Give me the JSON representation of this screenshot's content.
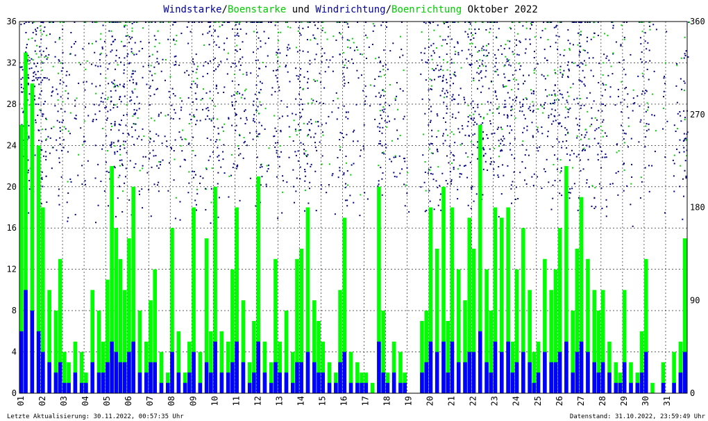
{
  "chart_data": {
    "type": "bar",
    "title_parts": [
      {
        "text": "Windstarke",
        "color": "#000099"
      },
      {
        "text": "/",
        "color": "#000000"
      },
      {
        "text": "Boenstarke",
        "color": "#00cc00"
      },
      {
        "text": " und ",
        "color": "#000000"
      },
      {
        "text": "Windrichtung",
        "color": "#000099"
      },
      {
        "text": "/",
        "color": "#000000"
      },
      {
        "text": "Boenrichtung",
        "color": "#00cc00"
      },
      {
        "text": " Oktober 2022",
        "color": "#000000"
      }
    ],
    "y_left": {
      "min": 0,
      "max": 36,
      "ticks": [
        "0",
        "4",
        "8",
        "12",
        "16",
        "20",
        "24",
        "28",
        "32",
        "36"
      ]
    },
    "y_right": {
      "min": 0,
      "max": 360,
      "ticks": [
        "0",
        "90",
        "180",
        "270",
        "360"
      ]
    },
    "x_days": [
      "01",
      "02",
      "03",
      "04",
      "05",
      "06",
      "07",
      "08",
      "09",
      "10",
      "11",
      "12",
      "13",
      "14",
      "15",
      "16",
      "17",
      "18",
      "19",
      "20",
      "21",
      "22",
      "23",
      "24",
      "25",
      "26",
      "27",
      "28",
      "29",
      "30",
      "31"
    ],
    "x_range": [
      1,
      32
    ],
    "grid": true,
    "colors": {
      "wind": "#0000ff",
      "gust": "#00ff00",
      "direction": "#000080",
      "gust_direction": "#00cc00",
      "grid": "#000000"
    },
    "series": [
      {
        "values": [
          [
            1.0,
            26
          ],
          [
            1.2,
            33
          ],
          [
            1.5,
            30
          ],
          [
            1.8,
            24
          ],
          [
            2.0,
            18
          ],
          [
            2.3,
            10
          ],
          [
            2.6,
            8
          ],
          [
            2.8,
            13
          ],
          [
            3.0,
            4
          ],
          [
            3.2,
            3
          ],
          [
            3.5,
            5
          ],
          [
            3.8,
            4
          ],
          [
            4.0,
            2
          ],
          [
            4.3,
            10
          ],
          [
            4.6,
            8
          ],
          [
            4.8,
            5
          ],
          [
            5.0,
            11
          ],
          [
            5.2,
            22
          ],
          [
            5.4,
            16
          ],
          [
            5.6,
            13
          ],
          [
            5.8,
            10
          ],
          [
            6.0,
            15
          ],
          [
            6.2,
            20
          ],
          [
            6.5,
            8
          ],
          [
            6.8,
            5
          ],
          [
            7.0,
            9
          ],
          [
            7.2,
            12
          ],
          [
            7.5,
            4
          ],
          [
            7.8,
            2
          ],
          [
            8.0,
            16
          ],
          [
            8.3,
            6
          ],
          [
            8.6,
            2
          ],
          [
            8.8,
            5
          ],
          [
            9.0,
            18
          ],
          [
            9.3,
            4
          ],
          [
            9.6,
            15
          ],
          [
            9.8,
            6
          ],
          [
            10.0,
            20
          ],
          [
            10.3,
            6
          ],
          [
            10.6,
            5
          ],
          [
            10.8,
            12
          ],
          [
            11.0,
            18
          ],
          [
            11.3,
            9
          ],
          [
            11.6,
            3
          ],
          [
            11.8,
            7
          ],
          [
            12.0,
            21
          ],
          [
            12.3,
            5
          ],
          [
            12.6,
            3
          ],
          [
            12.8,
            13
          ],
          [
            13.0,
            5
          ],
          [
            13.3,
            8
          ],
          [
            13.6,
            4
          ],
          [
            13.8,
            13
          ],
          [
            14.0,
            14
          ],
          [
            14.3,
            18
          ],
          [
            14.6,
            9
          ],
          [
            14.8,
            7
          ],
          [
            15.0,
            5
          ],
          [
            15.3,
            3
          ],
          [
            15.6,
            2
          ],
          [
            15.8,
            10
          ],
          [
            16.0,
            17
          ],
          [
            16.3,
            4
          ],
          [
            16.6,
            3
          ],
          [
            16.8,
            2
          ],
          [
            17.0,
            2
          ],
          [
            17.3,
            1
          ],
          [
            17.6,
            20
          ],
          [
            17.8,
            8
          ],
          [
            18.0,
            2
          ],
          [
            18.3,
            5
          ],
          [
            18.6,
            4
          ],
          [
            18.8,
            2
          ],
          [
            19.0,
            0
          ],
          [
            19.3,
            0
          ],
          [
            19.6,
            7
          ],
          [
            19.8,
            8
          ],
          [
            20.0,
            18
          ],
          [
            20.3,
            14
          ],
          [
            20.6,
            20
          ],
          [
            20.8,
            7
          ],
          [
            21.0,
            18
          ],
          [
            21.3,
            12
          ],
          [
            21.6,
            9
          ],
          [
            21.8,
            17
          ],
          [
            22.0,
            14
          ],
          [
            22.3,
            26
          ],
          [
            22.6,
            12
          ],
          [
            22.8,
            8
          ],
          [
            23.0,
            18
          ],
          [
            23.3,
            17
          ],
          [
            23.6,
            18
          ],
          [
            23.8,
            5
          ],
          [
            24.0,
            12
          ],
          [
            24.3,
            16
          ],
          [
            24.6,
            10
          ],
          [
            24.8,
            4
          ],
          [
            25.0,
            5
          ],
          [
            25.3,
            13
          ],
          [
            25.6,
            10
          ],
          [
            25.8,
            12
          ],
          [
            26.0,
            16
          ],
          [
            26.3,
            22
          ],
          [
            26.6,
            8
          ],
          [
            26.8,
            14
          ],
          [
            27.0,
            19
          ],
          [
            27.3,
            13
          ],
          [
            27.6,
            10
          ],
          [
            27.8,
            8
          ],
          [
            28.0,
            10
          ],
          [
            28.3,
            5
          ],
          [
            28.6,
            3
          ],
          [
            28.8,
            2
          ],
          [
            29.0,
            10
          ],
          [
            29.3,
            3
          ],
          [
            29.6,
            2
          ],
          [
            29.8,
            6
          ],
          [
            30.0,
            13
          ],
          [
            30.3,
            1
          ],
          [
            30.6,
            0
          ],
          [
            30.8,
            3
          ],
          [
            31.0,
            0
          ],
          [
            31.3,
            4
          ],
          [
            31.6,
            5
          ],
          [
            31.8,
            15
          ]
        ]
      },
      {
        "values": [
          [
            1.0,
            6
          ],
          [
            1.2,
            10
          ],
          [
            1.5,
            8
          ],
          [
            1.8,
            6
          ],
          [
            2.0,
            4
          ],
          [
            2.3,
            3
          ],
          [
            2.6,
            2
          ],
          [
            2.8,
            3
          ],
          [
            3.0,
            1
          ],
          [
            3.2,
            1
          ],
          [
            3.5,
            2
          ],
          [
            3.8,
            1
          ],
          [
            4.0,
            1
          ],
          [
            4.3,
            3
          ],
          [
            4.6,
            2
          ],
          [
            4.8,
            2
          ],
          [
            5.0,
            3
          ],
          [
            5.2,
            5
          ],
          [
            5.4,
            4
          ],
          [
            5.6,
            3
          ],
          [
            5.8,
            3
          ],
          [
            6.0,
            4
          ],
          [
            6.2,
            5
          ],
          [
            6.5,
            2
          ],
          [
            6.8,
            2
          ],
          [
            7.0,
            3
          ],
          [
            7.2,
            3
          ],
          [
            7.5,
            1
          ],
          [
            7.8,
            1
          ],
          [
            8.0,
            4
          ],
          [
            8.3,
            2
          ],
          [
            8.6,
            1
          ],
          [
            8.8,
            2
          ],
          [
            9.0,
            4
          ],
          [
            9.3,
            1
          ],
          [
            9.6,
            3
          ],
          [
            9.8,
            2
          ],
          [
            10.0,
            5
          ],
          [
            10.3,
            2
          ],
          [
            10.6,
            2
          ],
          [
            10.8,
            3
          ],
          [
            11.0,
            5
          ],
          [
            11.3,
            3
          ],
          [
            11.6,
            1
          ],
          [
            11.8,
            2
          ],
          [
            12.0,
            5
          ],
          [
            12.3,
            2
          ],
          [
            12.6,
            1
          ],
          [
            12.8,
            3
          ],
          [
            13.0,
            2
          ],
          [
            13.3,
            2
          ],
          [
            13.6,
            1
          ],
          [
            13.8,
            3
          ],
          [
            14.0,
            3
          ],
          [
            14.3,
            4
          ],
          [
            14.6,
            3
          ],
          [
            14.8,
            2
          ],
          [
            15.0,
            2
          ],
          [
            15.3,
            1
          ],
          [
            15.6,
            1
          ],
          [
            15.8,
            3
          ],
          [
            16.0,
            4
          ],
          [
            16.3,
            1
          ],
          [
            16.6,
            1
          ],
          [
            16.8,
            1
          ],
          [
            17.0,
            1
          ],
          [
            17.3,
            0
          ],
          [
            17.6,
            5
          ],
          [
            17.8,
            2
          ],
          [
            18.0,
            1
          ],
          [
            18.3,
            2
          ],
          [
            18.6,
            1
          ],
          [
            18.8,
            1
          ],
          [
            19.0,
            0
          ],
          [
            19.3,
            0
          ],
          [
            19.6,
            2
          ],
          [
            19.8,
            3
          ],
          [
            20.0,
            5
          ],
          [
            20.3,
            4
          ],
          [
            20.6,
            5
          ],
          [
            20.8,
            2
          ],
          [
            21.0,
            5
          ],
          [
            21.3,
            3
          ],
          [
            21.6,
            3
          ],
          [
            21.8,
            4
          ],
          [
            22.0,
            4
          ],
          [
            22.3,
            6
          ],
          [
            22.6,
            3
          ],
          [
            22.8,
            2
          ],
          [
            23.0,
            5
          ],
          [
            23.3,
            4
          ],
          [
            23.6,
            5
          ],
          [
            23.8,
            2
          ],
          [
            24.0,
            3
          ],
          [
            24.3,
            4
          ],
          [
            24.6,
            3
          ],
          [
            24.8,
            1
          ],
          [
            25.0,
            2
          ],
          [
            25.3,
            4
          ],
          [
            25.6,
            3
          ],
          [
            25.8,
            3
          ],
          [
            26.0,
            4
          ],
          [
            26.3,
            5
          ],
          [
            26.6,
            2
          ],
          [
            26.8,
            4
          ],
          [
            27.0,
            5
          ],
          [
            27.3,
            4
          ],
          [
            27.6,
            3
          ],
          [
            27.8,
            2
          ],
          [
            28.0,
            3
          ],
          [
            28.3,
            2
          ],
          [
            28.6,
            1
          ],
          [
            28.8,
            1
          ],
          [
            29.0,
            3
          ],
          [
            29.3,
            1
          ],
          [
            29.6,
            1
          ],
          [
            29.8,
            2
          ],
          [
            30.0,
            4
          ],
          [
            30.3,
            0
          ],
          [
            30.6,
            0
          ],
          [
            30.8,
            1
          ],
          [
            31.0,
            0
          ],
          [
            31.3,
            1
          ],
          [
            31.6,
            2
          ],
          [
            31.8,
            4
          ]
        ]
      }
    ],
    "footer_left": "Letzte Aktualisierung: 30.11.2022, 00:57:35 Uhr",
    "footer_right": "Datenstand: 31.10.2022, 23:59:49 Uhr"
  }
}
